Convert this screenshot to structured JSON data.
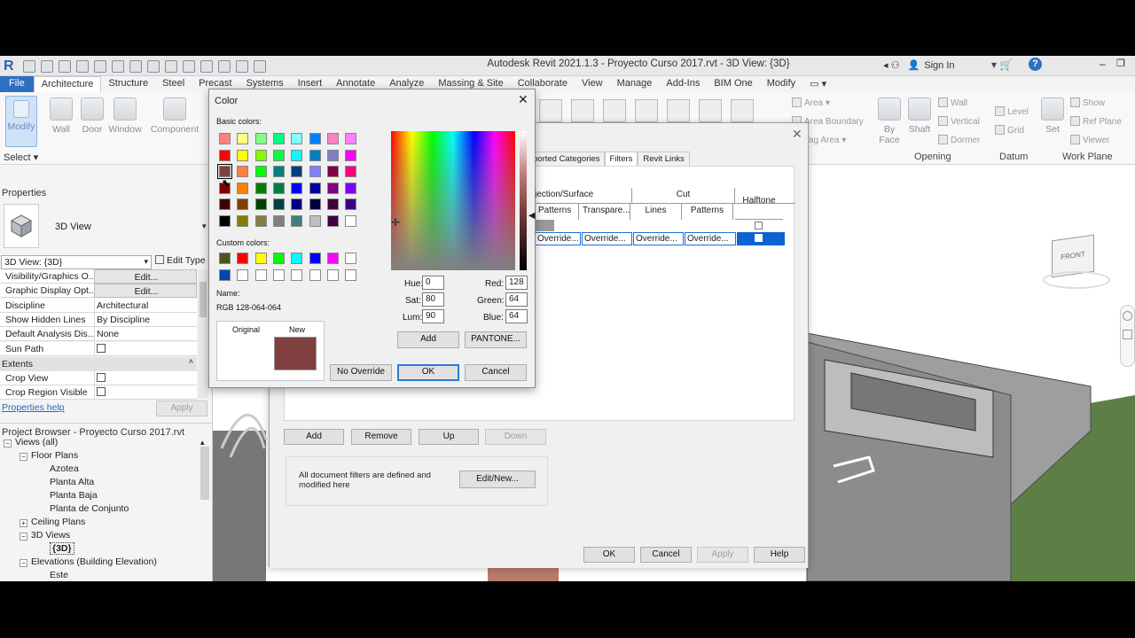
{
  "app": {
    "title": "Autodesk Revit 2021.1.3 - Proyecto Curso 2017.rvt - 3D View: {3D}",
    "sign_in": "Sign In"
  },
  "ribbon": {
    "tabs": [
      "File",
      "Architecture",
      "Structure",
      "Steel",
      "Precast",
      "Systems",
      "Insert",
      "Annotate",
      "Analyze",
      "Massing & Site",
      "Collaborate",
      "View",
      "Manage",
      "Add-Ins",
      "BIM One",
      "Modify"
    ],
    "active_tab": "Architecture",
    "modify_label": "Modify",
    "select_label": "Select",
    "wall_label": "Wall",
    "door_label": "Door",
    "window_label": "Window",
    "component_label": "Component",
    "area_label": "Area",
    "area_boundary_label": "Area  Boundary",
    "tag_area_label": "Tag   Area",
    "by_face_label": "By\nFace",
    "shaft_label": "Shaft",
    "wall_small": "Wall",
    "vertical_small": "Vertical",
    "dormer_small": "Dormer",
    "level_small": "Level",
    "grid_small": "Grid",
    "set_label": "Set",
    "show_small": "Show",
    "ref_plane_small": "Ref  Plane",
    "viewer_small": "Viewer",
    "group_opening": "Opening",
    "group_datum": "Datum",
    "group_work_plane": "Work Plane"
  },
  "properties": {
    "header": "Properties",
    "type_name": "3D View",
    "selector_value": "3D View: {3D}",
    "edit_type": "Edit Type",
    "rows": [
      {
        "key": "Visibility/Graphics O...",
        "value": "Edit..."
      },
      {
        "key": "Graphic Display Opt...",
        "value": "Edit..."
      },
      {
        "key": "Discipline",
        "value": "Architectural"
      },
      {
        "key": "Show Hidden Lines",
        "value": "By Discipline"
      },
      {
        "key": "Default Analysis Dis...",
        "value": "None"
      },
      {
        "key": "Sun Path",
        "value": ""
      }
    ],
    "extents_header": "Extents",
    "extent_rows": [
      {
        "key": "Crop View",
        "value": ""
      },
      {
        "key": "Crop Region Visible",
        "value": ""
      }
    ],
    "help_link": "Properties help",
    "apply": "Apply"
  },
  "project_browser": {
    "header": "Project Browser - Proyecto Curso 2017.rvt",
    "items": [
      {
        "label": "Views (all)",
        "level": 0
      },
      {
        "label": "Floor Plans",
        "level": 1
      },
      {
        "label": "Azotea",
        "level": 2
      },
      {
        "label": "Planta Alta",
        "level": 2
      },
      {
        "label": "Planta Baja",
        "level": 2
      },
      {
        "label": "Planta de Conjunto",
        "level": 2
      },
      {
        "label": "Ceiling Plans",
        "level": 1
      },
      {
        "label": "3D Views",
        "level": 1
      },
      {
        "label": "{3D}",
        "level": 2
      },
      {
        "label": "Elevations (Building Elevation)",
        "level": 1
      },
      {
        "label": "Este",
        "level": 2
      }
    ]
  },
  "vg_dialog": {
    "tabs": [
      "ported Categories",
      "Filters",
      "Revit Links"
    ],
    "active_tab": "Filters",
    "col_projection": "jection/Surface",
    "col_cut": "Cut",
    "col_halftone": "Halftone",
    "sub_patterns": "Patterns",
    "sub_transparency": "Transpare...",
    "sub_lines": "Lines",
    "sub_patterns2": "Patterns",
    "override_cells": [
      "Override...",
      "Override...",
      "Override...",
      "Override..."
    ],
    "add": "Add",
    "remove": "Remove",
    "up": "Up",
    "down": "Down",
    "note": "All document filters are defined and modified here",
    "edit_new": "Edit/New...",
    "ok": "OK",
    "cancel": "Cancel",
    "apply": "Apply",
    "help": "Help"
  },
  "color_dialog": {
    "title": "Color",
    "basic_colors_label": "Basic colors:",
    "custom_colors_label": "Custom colors:",
    "name_label": "Name:",
    "name_value": "RGB 128-064-064",
    "original_label": "Original",
    "new_label": "New",
    "hue_label": "Hue:",
    "hue": "0",
    "sat_label": "Sat:",
    "sat": "80",
    "lum_label": "Lum:",
    "lum": "90",
    "red_label": "Red:",
    "red": "128",
    "green_label": "Green:",
    "green": "64",
    "blue_label": "Blue:",
    "blue": "64",
    "add": "Add",
    "pantone": "PANTONE...",
    "no_override": "No Override",
    "ok": "OK",
    "cancel": "Cancel",
    "new_color": "#804040",
    "basic_colors": [
      [
        "#ff8080",
        "#ffff80",
        "#80ff80",
        "#00ff80",
        "#80ffff",
        "#0080ff",
        "#ff80c0",
        "#ff80ff"
      ],
      [
        "#ff0000",
        "#ffff00",
        "#80ff00",
        "#00ff40",
        "#00ffff",
        "#0080c0",
        "#8080c0",
        "#ff00ff"
      ],
      [
        "#804040",
        "#ff8040",
        "#00ff00",
        "#008080",
        "#004080",
        "#8080ff",
        "#800040",
        "#ff0080"
      ],
      [
        "#800000",
        "#ff8000",
        "#008000",
        "#008040",
        "#0000ff",
        "#0000a0",
        "#800080",
        "#8000ff"
      ],
      [
        "#400000",
        "#804000",
        "#004000",
        "#004040",
        "#000080",
        "#000040",
        "#400040",
        "#400080"
      ],
      [
        "#000000",
        "#808000",
        "#808040",
        "#808080",
        "#408080",
        "#c0c0c0",
        "#400040",
        "#ffffff"
      ]
    ],
    "custom_colors": [
      [
        "#4b5320",
        "#ff0000",
        "#ffff00",
        "#00ff00",
        "#00ffff",
        "#0000ff",
        "#ff00ff",
        "#ffffff"
      ],
      [
        "#0047ab",
        "#ffffff",
        "#ffffff",
        "#ffffff",
        "#ffffff",
        "#ffffff",
        "#ffffff",
        "#ffffff"
      ]
    ]
  },
  "viewcube": {
    "front": "FRONT"
  }
}
